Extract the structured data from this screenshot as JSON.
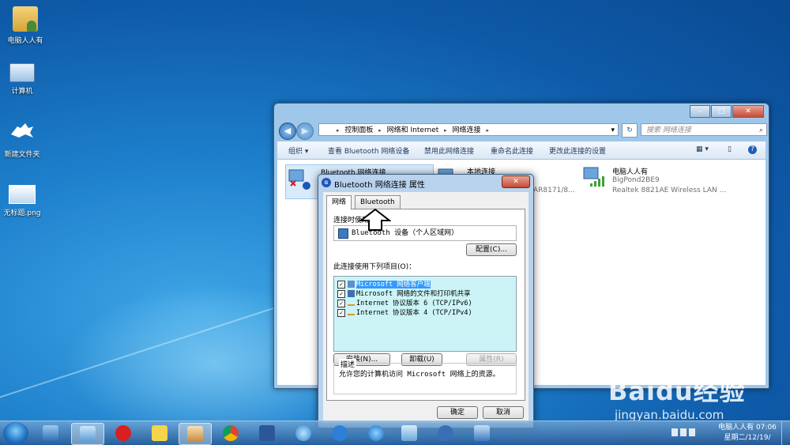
{
  "desktop": {
    "icons": [
      {
        "label": "电脑人人有",
        "icon": "user-folder-icon"
      },
      {
        "label": "计算机",
        "icon": "computer-icon"
      },
      {
        "label": "新建文件夹",
        "icon": "folder-icon"
      },
      {
        "label": "无标题.png",
        "icon": "image-file-icon"
      }
    ]
  },
  "explorer": {
    "breadcrumb": [
      "控制面板",
      "网络和 Internet",
      "网络连接"
    ],
    "search_placeholder": "搜索 网络连接",
    "commands": [
      "组织 ▾",
      "查看 Bluetooth 网络设备",
      "禁用此网络连接",
      "重命名此连接",
      "更改此连接的设置"
    ],
    "connections": [
      {
        "name": "Bluetooth 网络连接",
        "status": "",
        "adapter": ""
      },
      {
        "name": "本地连接",
        "status": "",
        "adapter": "AR8171/8..."
      },
      {
        "name": "电脑人人有",
        "status": "BigPond2BE9",
        "adapter": "Realtek 8821AE Wireless LAN ..."
      }
    ]
  },
  "dialog": {
    "title": "Bluetooth 网络连接 属性",
    "close_label": "✕",
    "tabs": [
      "网络",
      "Bluetooth"
    ],
    "connect_using_label": "连接时使用：",
    "device": "Bluetooth 设备（个人区域网）",
    "configure_label": "配置(C)...",
    "items_label": "此连接使用下列项目(O)：",
    "items": [
      {
        "label": "Microsoft 网络客户端",
        "checked": true,
        "selected": true
      },
      {
        "label": "Microsoft 网络的文件和打印机共享",
        "checked": true,
        "selected": false
      },
      {
        "label": "Internet 协议版本 6 (TCP/IPv6)",
        "checked": true,
        "selected": false
      },
      {
        "label": "Internet 协议版本 4 (TCP/IPv4)",
        "checked": true,
        "selected": false
      }
    ],
    "install_label": "安装(N)...",
    "uninstall_label": "卸载(U)",
    "properties_label": "属性(R)",
    "description_legend": "描述",
    "description_text": "允许您的计算机访问 Microsoft 网络上的资源。",
    "ok_label": "确定",
    "cancel_label": "取消"
  },
  "watermark": {
    "brand": "Baidu经验",
    "url": "jingyan.baidu.com"
  },
  "taskbar": {
    "clock_time": "电脑人人有 07:06",
    "clock_date": "星期二/12/19/"
  },
  "colors": {
    "list_bg": "#ccf4f6",
    "selected": "#3399ff",
    "close_red": "#c74a34"
  }
}
